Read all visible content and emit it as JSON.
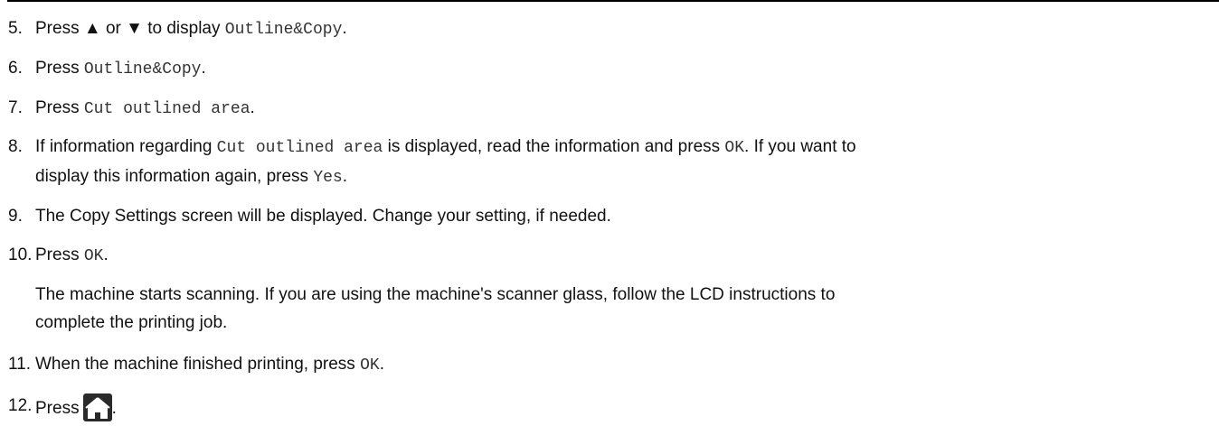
{
  "rule_color": "#000000",
  "steps": [
    {
      "number": "5.",
      "parts": [
        "Press ",
        "▲",
        " or ",
        "▼",
        " to display ",
        "Outline&Copy",
        "."
      ]
    },
    {
      "number": "6.",
      "parts": [
        "Press ",
        "Outline&Copy",
        "."
      ]
    },
    {
      "number": "7.",
      "parts": [
        "Press ",
        "Cut outlined area",
        "."
      ]
    },
    {
      "number": "8.",
      "line1": [
        "If information regarding ",
        "Cut outlined area",
        " is displayed, read the information and press ",
        "OK",
        ". If you want to"
      ],
      "line2": [
        "display this information again, press ",
        "Yes",
        "."
      ]
    },
    {
      "number": "9.",
      "text": "The Copy Settings screen will be displayed. Change your setting, if needed."
    },
    {
      "number": "10.",
      "parts": [
        "Press ",
        "OK",
        "."
      ],
      "note_line1": "The machine starts scanning. If you are using the machine's scanner glass, follow the LCD instructions to",
      "note_line2": "complete the printing job."
    },
    {
      "number": "11.",
      "parts": [
        "When the machine finished printing, press ",
        "OK",
        "."
      ]
    },
    {
      "number": "12.",
      "parts": [
        "Press",
        "."
      ],
      "icon": "home-icon"
    }
  ]
}
